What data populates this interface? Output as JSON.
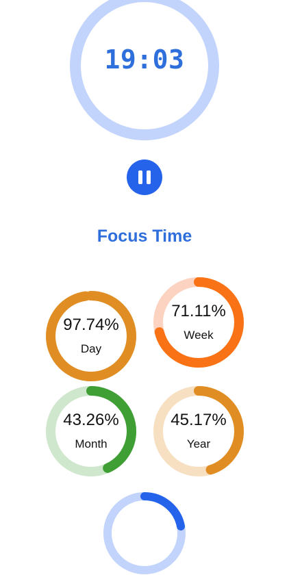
{
  "timer": {
    "time": "19:03",
    "ring_color": "#c2d4fb"
  },
  "controls": {
    "pause_icon": "pause-icon",
    "accent": "#2563eb"
  },
  "section": {
    "title": "Focus Time"
  },
  "stats": [
    {
      "key": "day",
      "percent_text": "97.74%",
      "label": "Day",
      "progress": 0.9774,
      "color": "#e08e24",
      "track": "#f5d9b2"
    },
    {
      "key": "week",
      "percent_text": "71.11%",
      "label": "Week",
      "progress": 0.7111,
      "color": "#f97316",
      "track": "#fcd3c0"
    },
    {
      "key": "month",
      "percent_text": "43.26%",
      "label": "Month",
      "progress": 0.4326,
      "color": "#3f9e34",
      "track": "#cfe7cc"
    },
    {
      "key": "year",
      "percent_text": "45.17%",
      "label": "Year",
      "progress": 0.4517,
      "color": "#e08e24",
      "track": "#f7dfc2"
    }
  ],
  "bottom_ring": {
    "progress": 0.22,
    "color": "#2563eb",
    "track": "#c2d4fb"
  }
}
